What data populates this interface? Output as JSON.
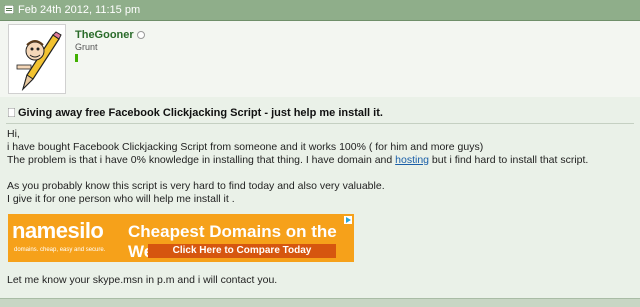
{
  "post": {
    "date": "Feb 24th 2012,   11:15 pm"
  },
  "user": {
    "name": "TheGooner",
    "title": "Grunt"
  },
  "thread": {
    "title": "Giving away free Facebook Clickjacking Script - just help me install it."
  },
  "message": {
    "line1": "Hi,",
    "line2": "i have bought Facebook Clickjacking Script from someone and it works 100% ( for him and more guys)",
    "line3_before": "The problem is that i have 0% knowledge in installing that thing. I have domain and ",
    "line3_link": "hosting",
    "line3_after": " but i find hard to install that script.",
    "line4": "As you probably know this script is very hard to find today and also very valuable.",
    "line5": "I give it for one person who will help me install it .",
    "line6": "Let me know your skype.msn in p.m and i will contact you."
  },
  "ad": {
    "logo": "namesilo",
    "tagline": "domains. cheap, easy and secure.",
    "headline": "Cheapest Domains on the Web!",
    "cta": "Click Here to Compare Today"
  },
  "colors": {
    "header": "#8fae8a",
    "username": "#2a6b2a",
    "link": "#1a5fa8",
    "ad_orange": "#f6a11a"
  }
}
